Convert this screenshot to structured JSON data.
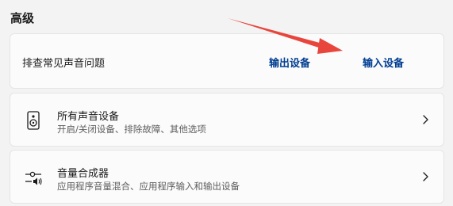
{
  "section": {
    "title": "高级"
  },
  "troubleshoot": {
    "label": "排查常见声音问题",
    "output_link": "输出设备",
    "input_link": "输入设备"
  },
  "all_devices": {
    "title": "所有声音设备",
    "description": "开启/关闭设备、排除故障、其他选项",
    "icon": "speaker-icon"
  },
  "mixer": {
    "title": "音量合成器",
    "description": "应用程序音量混合、应用程序输入和输出设备",
    "icon": "volume-mixer-icon"
  },
  "colors": {
    "link": "#003e92",
    "annotation_arrow": "#e8453c",
    "background": "#f3f3f3",
    "card": "#fbfbfb"
  }
}
